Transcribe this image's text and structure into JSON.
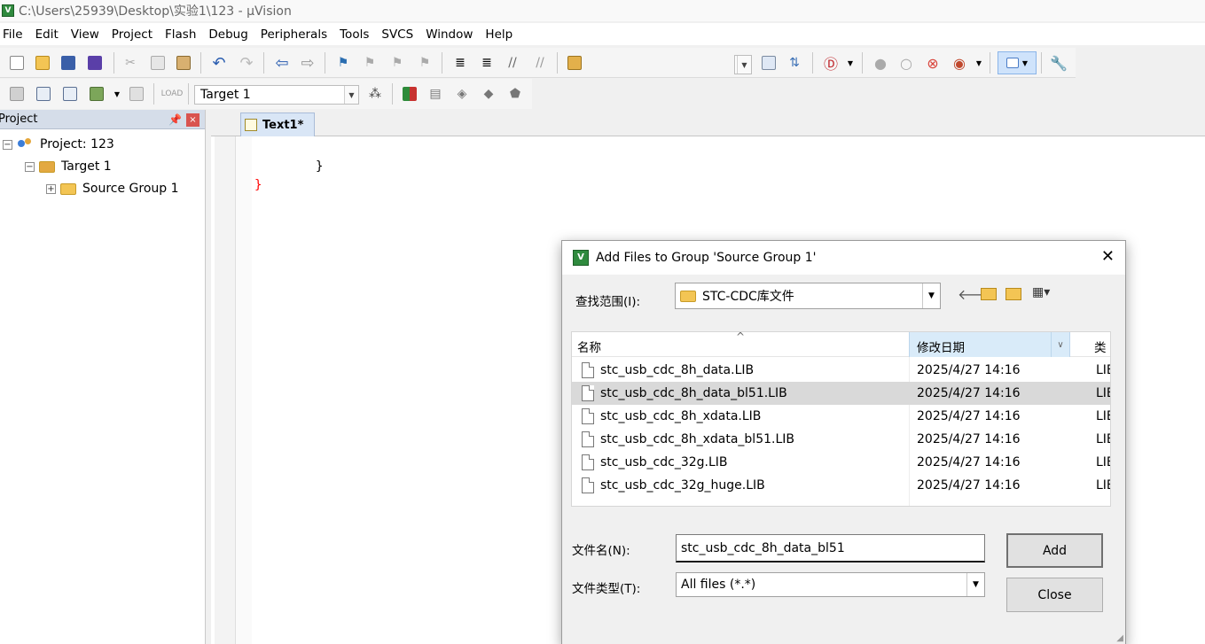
{
  "window": {
    "title": "C:\\Users\\25939\\Desktop\\实验1\\123 - µVision",
    "app_icon": "V"
  },
  "menu": [
    "File",
    "Edit",
    "View",
    "Project",
    "Flash",
    "Debug",
    "Peripherals",
    "Tools",
    "SVCS",
    "Window",
    "Help"
  ],
  "toolbar2": {
    "target": "Target 1"
  },
  "project_panel": {
    "title": "Project",
    "tree": {
      "project": "Project: 123",
      "target": "Target 1",
      "group": "Source Group 1",
      "expanded_sign": "−",
      "collapsed_sign": "+"
    }
  },
  "editor": {
    "tab": "Text1*",
    "lines": [
      {
        "text": "}",
        "color": "#000000"
      },
      {
        "text": "}",
        "color": "#ff0000"
      }
    ]
  },
  "dialog": {
    "title": "Add Files to Group 'Source Group 1'",
    "close_glyph": "✕",
    "look_in_label": "查找范围(I):",
    "look_in_value": "STC-CDC库文件",
    "columns": {
      "name": "名称",
      "date": "修改日期",
      "type": "类"
    },
    "files": [
      {
        "name": "stc_usb_cdc_8h_data.LIB",
        "date": "2025/4/27 14:16",
        "type": "LIB"
      },
      {
        "name": "stc_usb_cdc_8h_data_bl51.LIB",
        "date": "2025/4/27 14:16",
        "type": "LIB"
      },
      {
        "name": "stc_usb_cdc_8h_xdata.LIB",
        "date": "2025/4/27 14:16",
        "type": "LIB"
      },
      {
        "name": "stc_usb_cdc_8h_xdata_bl51.LIB",
        "date": "2025/4/27 14:16",
        "type": "LIB"
      },
      {
        "name": "stc_usb_cdc_32g.LIB",
        "date": "2025/4/27 14:16",
        "type": "LIB"
      },
      {
        "name": "stc_usb_cdc_32g_huge.LIB",
        "date": "2025/4/27 14:16",
        "type": "LIB"
      }
    ],
    "selected_file": "stc_usb_cdc_8h_data_bl51.LIB",
    "filename_label": "文件名(N):",
    "filename_value": "stc_usb_cdc_8h_data_bl51",
    "filetype_label": "文件类型(T):",
    "filetype_value": "All files (*.*)",
    "add_button": "Add",
    "close_button": "Close"
  }
}
